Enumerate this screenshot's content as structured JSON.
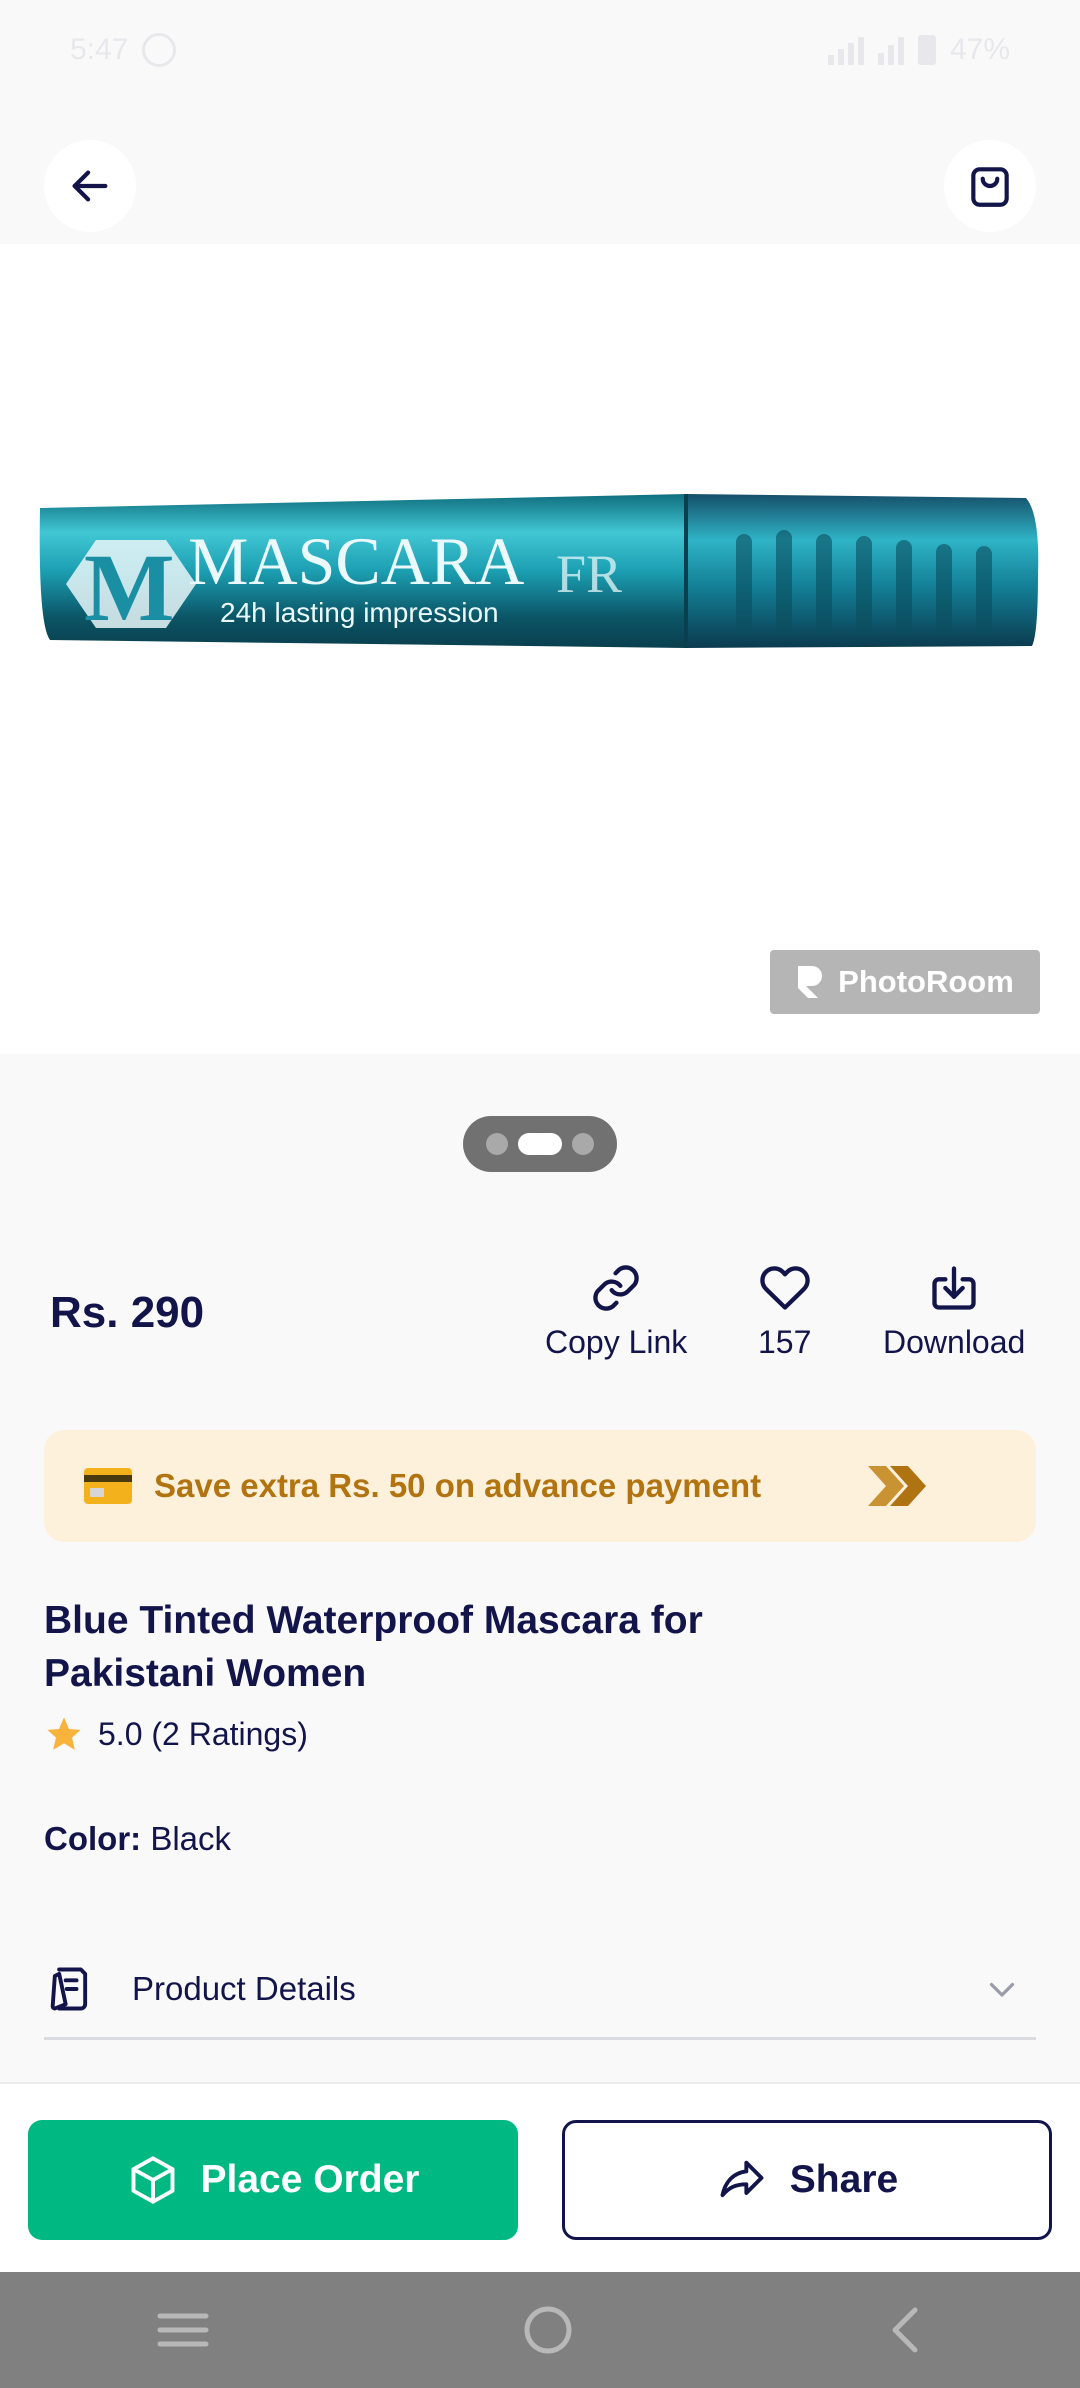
{
  "status_bar": {
    "time": "5:47",
    "battery": "47%"
  },
  "image": {
    "brand_text": "MASCARA",
    "tagline": "24h lasting impression",
    "watermark": "PhotoRoom",
    "pager": {
      "count": 3,
      "active_index": 1
    }
  },
  "product": {
    "price": "Rs. 290",
    "title": "Blue Tinted Waterproof Mascara for Pakistani Women",
    "rating": "5.0 (2 Ratings)",
    "color_label": "Color:",
    "color_value": "Black"
  },
  "actions": {
    "copy_link": "Copy Link",
    "likes": "157",
    "download": "Download"
  },
  "promo": {
    "text": "Save extra Rs. 50 on advance payment"
  },
  "details": {
    "label": "Product Details"
  },
  "bottom": {
    "place_order": "Place Order",
    "share": "Share"
  },
  "colors": {
    "primary_text": "#13154a",
    "accent_green": "#00b982",
    "promo_bg": "#fef1dc",
    "promo_text": "#b17410",
    "star": "#f7b33c"
  }
}
